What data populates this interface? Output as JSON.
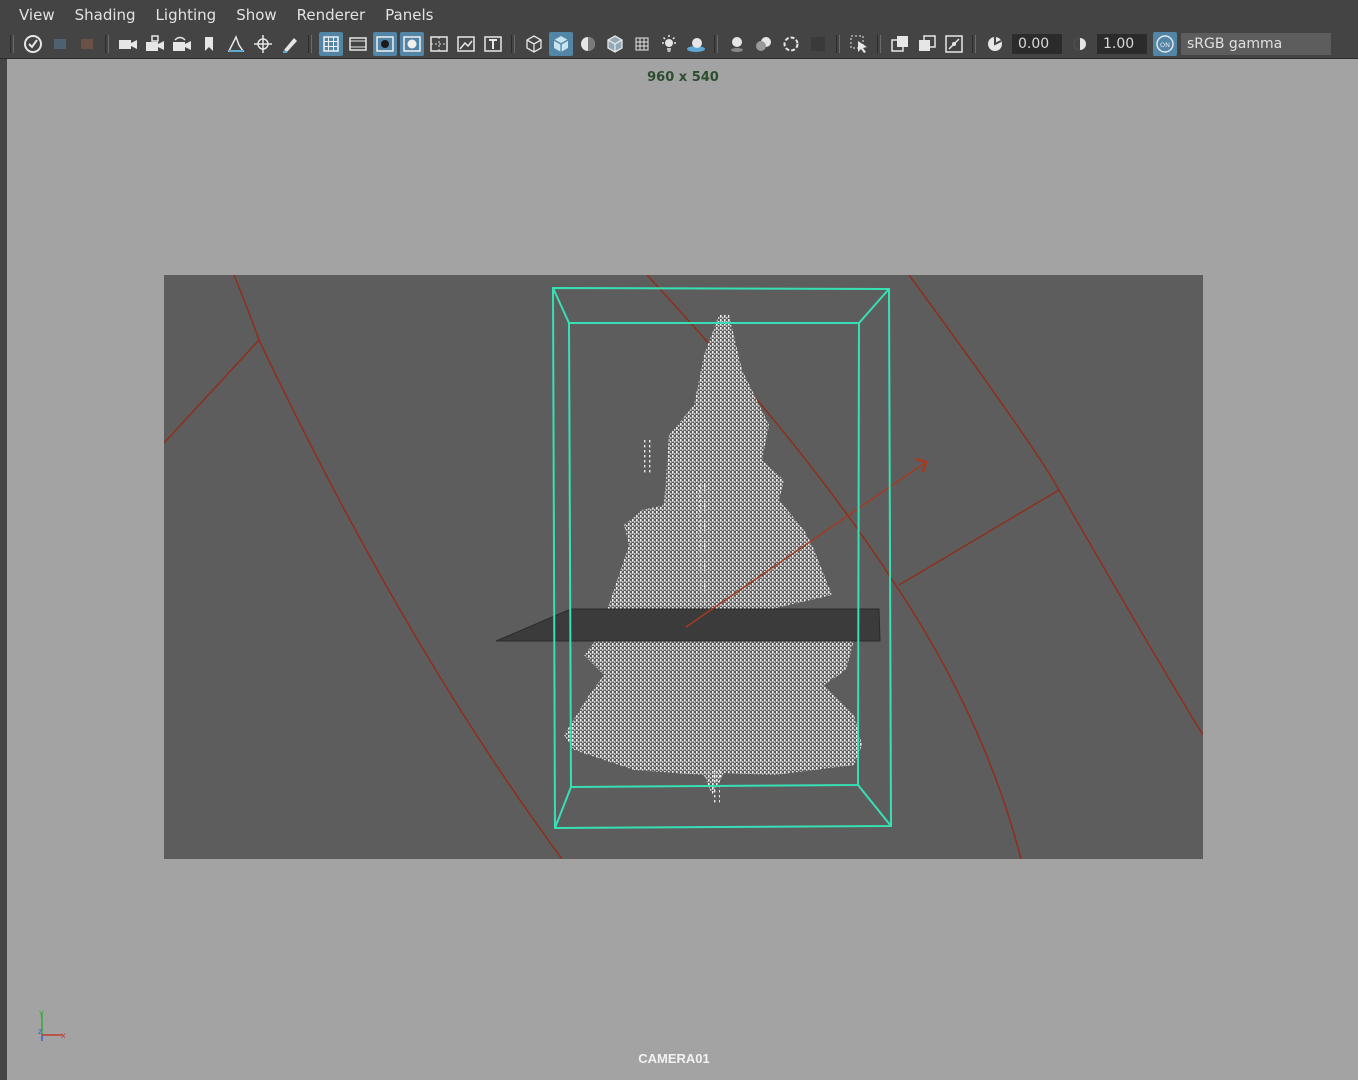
{
  "menu": {
    "items": [
      {
        "label": "View"
      },
      {
        "label": "Shading"
      },
      {
        "label": "Lighting"
      },
      {
        "label": "Show"
      },
      {
        "label": "Renderer"
      },
      {
        "label": "Panels"
      }
    ]
  },
  "toolbar": {
    "exposure_value": "0.00",
    "gamma_value": "1.00",
    "color_management_label": "sRGB gamma",
    "color_management_badge": "ON",
    "accent_color": "#5285a6"
  },
  "viewport": {
    "resolution_label": "960 x 540",
    "camera_label": "CAMERA01",
    "background_color": "#a3a3a3",
    "gate_color": "#5d5d5d",
    "bounding_box_color": "#37e0b4",
    "curve_color": "#8e2f1d"
  }
}
